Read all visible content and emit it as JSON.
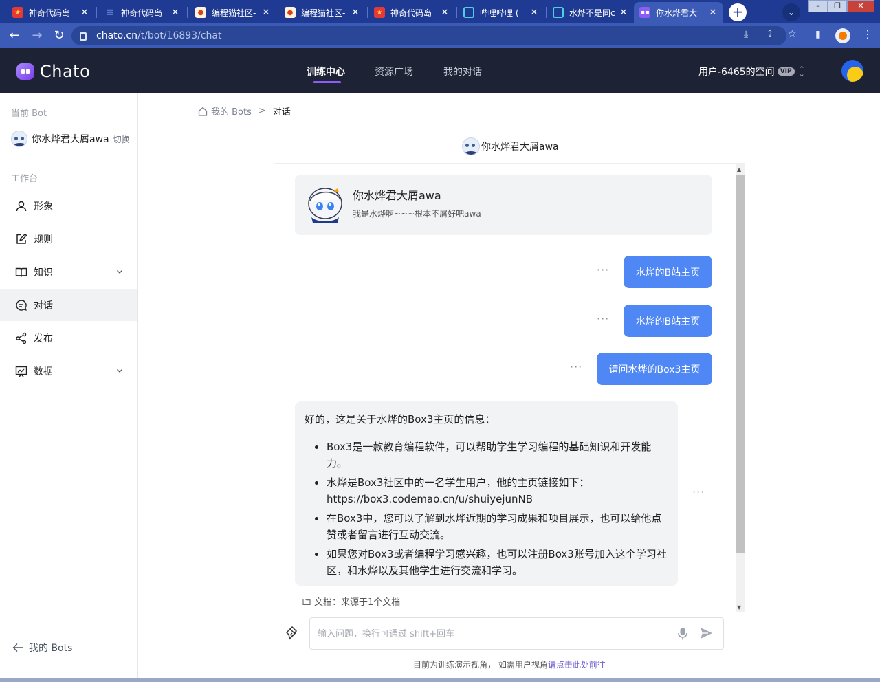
{
  "browser": {
    "tabs": [
      {
        "label": "神奇代码岛",
        "favicon": "star-red"
      },
      {
        "label": "神奇代码岛",
        "favicon": "doc-blue"
      },
      {
        "label": "编程猫社区-",
        "favicon": "cat-red"
      },
      {
        "label": "编程猫社区-",
        "favicon": "cat-red"
      },
      {
        "label": "神奇代码岛",
        "favicon": "star-red"
      },
      {
        "label": "哔哩哔哩 (",
        "favicon": "tv-cyan"
      },
      {
        "label": "水烨不是同c",
        "favicon": "tv-cyan"
      },
      {
        "label": "你水烨君大",
        "favicon": "chato-purple"
      }
    ],
    "url_host": "chato.cn",
    "url_path": "/t/bot/16893/chat"
  },
  "app": {
    "logo_text": "Chato",
    "nav": [
      {
        "label": "训练中心",
        "active": true
      },
      {
        "label": "资源广场",
        "active": false
      },
      {
        "label": "我的对话",
        "active": false
      }
    ],
    "space_label": "用户-6465的空间",
    "vip_badge": "VIP"
  },
  "sidebar": {
    "current_bot_label": "当前 Bot",
    "bot_name": "你水烨君大屑awa",
    "switch_label": "切换",
    "workbench_label": "工作台",
    "items": [
      {
        "label": "形象",
        "icon": "user-icon"
      },
      {
        "label": "规则",
        "icon": "edit-icon"
      },
      {
        "label": "知识",
        "icon": "book-icon",
        "expandable": true
      },
      {
        "label": "对话",
        "icon": "chat-icon",
        "active": true
      },
      {
        "label": "发布",
        "icon": "share-icon"
      },
      {
        "label": "数据",
        "icon": "chart-icon",
        "expandable": true
      }
    ],
    "back_label": "我的 Bots"
  },
  "breadcrumb": {
    "home": "我的 Bots",
    "separator": ">",
    "current": "对话"
  },
  "chat": {
    "title": "你水烨君大屑awa",
    "intro": {
      "name": "你水烨君大屑awa",
      "desc": "我是水烨啊~~~根本不屑好吧awa"
    },
    "user_messages": [
      "水烨的B站主页",
      "水烨的B站主页",
      "请问水烨的Box3主页"
    ],
    "bot_reply": {
      "intro": "好的，这是关于水烨的Box3主页的信息：",
      "bullets": [
        "Box3是一款教育编程软件，可以帮助学生学习编程的基础知识和开发能力。",
        "水烨是Box3社区中的一名学生用户，他的主页链接如下：https://box3.codemao.cn/u/shuiyejunNB",
        "在Box3中，您可以了解到水烨近期的学习成果和项目展示，也可以给他点赞或者留言进行互动交流。",
        "如果您对Box3或者编程学习感兴趣，也可以注册Box3账号加入这个学习社区，和水烨以及其他学生进行交流和学习。"
      ]
    },
    "more_label": "···",
    "source": "文档：来源于1个文档"
  },
  "composer": {
    "placeholder": "输入问题，换行可通过 shift+回车",
    "value": ""
  },
  "footer": {
    "note": "目前为训练演示视角， 如需用户视角",
    "link": "请点击此处前往"
  },
  "colors": {
    "header_bg": "#1e2235",
    "accent": "#8b5cf6",
    "user_bubble": "#4f87f5",
    "browser_tab": "#1f3a93"
  }
}
